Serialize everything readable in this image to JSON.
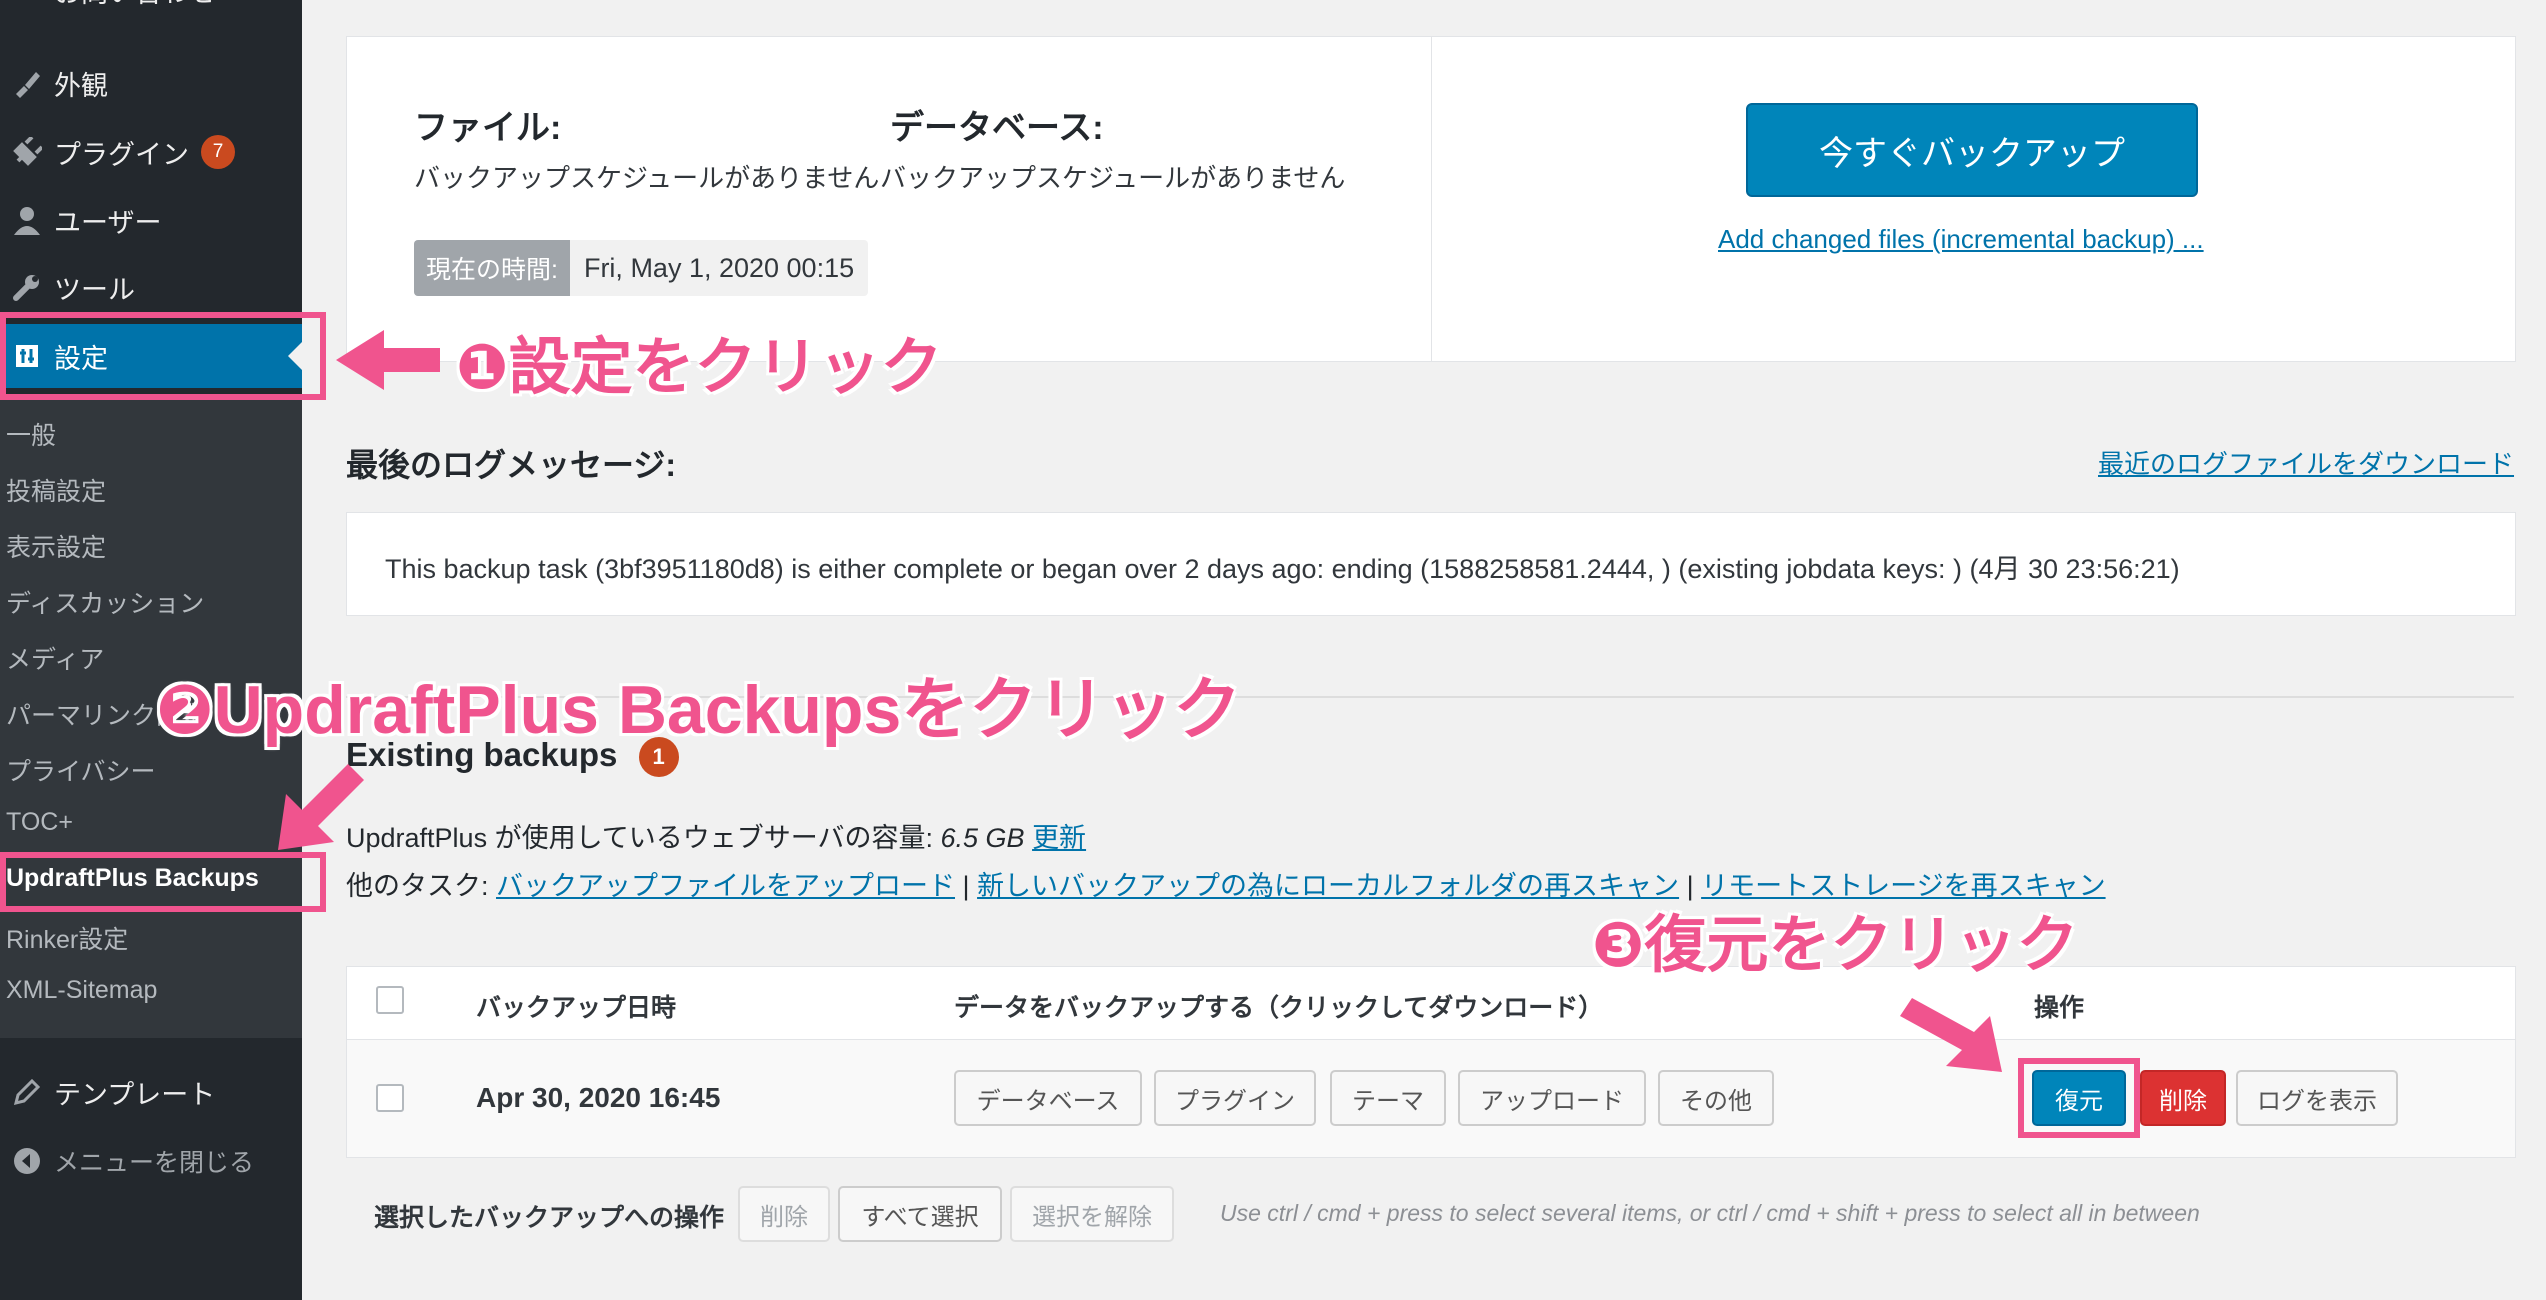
{
  "sidebar": {
    "top_partial": "お問い合わせ",
    "items": [
      {
        "label": "外観",
        "icon": "brush-icon"
      },
      {
        "label": "プラグイン",
        "icon": "plugin-icon",
        "badge": "7"
      },
      {
        "label": "ユーザー",
        "icon": "user-icon"
      },
      {
        "label": "ツール",
        "icon": "wrench-icon"
      },
      {
        "label": "設定",
        "icon": "settings-icon"
      }
    ],
    "submenu": [
      "一般",
      "投稿設定",
      "表示設定",
      "ディスカッション",
      "メディア",
      "パーマリンク設定",
      "プライバシー",
      "TOC+",
      "UpdraftPlus Backups",
      "Rinker設定",
      "XML-Sitemap"
    ],
    "bottom_items": [
      {
        "label": "テンプレート",
        "icon": "pencil-icon"
      },
      {
        "label": "メニューを閉じる",
        "icon": "collapse-icon"
      }
    ]
  },
  "status": {
    "files_heading": "ファイル:",
    "files_schedule": "バックアップスケジュールがありません",
    "db_heading": "データベース:",
    "db_schedule": "バックアップスケジュールがありません",
    "time_label": "現在の時間:",
    "time_value": "Fri, May 1, 2020 00:15",
    "backup_now_label": "今すぐバックアップ",
    "incremental_link": "Add changed files (incremental backup) ..."
  },
  "log": {
    "heading": "最後のログメッセージ:",
    "download_link": "最近のログファイルをダウンロード",
    "message": "This backup task (3bf3951180d8) is either complete or began over 2 days ago: ending (1588258581.2444, ) (existing jobdata keys: ) (4月 30 23:56:21)"
  },
  "existing": {
    "heading": "Existing backups",
    "count": "1",
    "usage_prefix": "UpdraftPlus が使用しているウェブサーバの容量: ",
    "usage_value": "6.5 GB",
    "usage_refresh": "更新",
    "tasks_label": "他のタスク: ",
    "task_upload": "バックアップファイルをアップロード",
    "task_rescan_local": "新しいバックアップの為にローカルフォルダの再スキャン",
    "task_rescan_remote": "リモートストレージを再スキャン",
    "sep": "|"
  },
  "table": {
    "col_date": "バックアップ日時",
    "col_data": "データをバックアップする（クリックしてダウンロード）",
    "col_actions": "操作",
    "row": {
      "date": "Apr 30, 2020 16:45",
      "data_buttons": [
        "データベース",
        "プラグイン",
        "テーマ",
        "アップロード",
        "その他"
      ],
      "restore": "復元",
      "delete": "削除",
      "view_log": "ログを表示"
    }
  },
  "bulk": {
    "label": "選択したバックアップへの操作",
    "delete": "削除",
    "select_all": "すべて選択",
    "deselect": "選択を解除",
    "hint": "Use ctrl / cmd + press to select several items, or ctrl / cmd + shift + press to select all in between"
  },
  "annotations": {
    "step1": "❶設定をクリック",
    "step2": "❷UpdraftPlus Backupsをクリック",
    "step3": "❸復元をクリック"
  },
  "colors": {
    "annotation": "#f0548e",
    "wp_blue": "#0073aa",
    "sidebar_bg": "#23282d"
  }
}
